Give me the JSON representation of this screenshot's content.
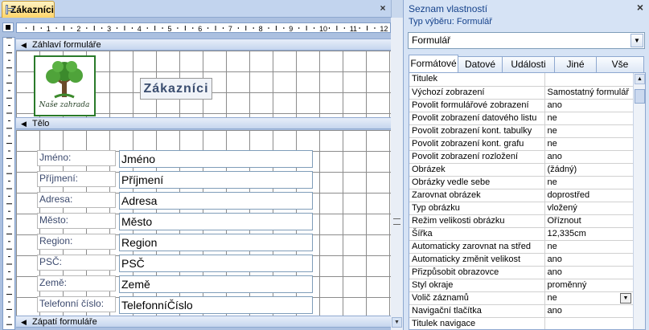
{
  "document_tab": {
    "title": "Zákazníci",
    "icon": "form-icon"
  },
  "form": {
    "header_section": "Záhlaví formuláře",
    "logo_text": "Naše zahrada",
    "title_label": "Zákazníci",
    "detail_section": "Tělo",
    "footer_section": "Zápatí formuláře",
    "fields": [
      {
        "label": "Jméno:",
        "value": "Jméno"
      },
      {
        "label": "Příjmení:",
        "value": "Příjmení"
      },
      {
        "label": "Adresa:",
        "value": "Adresa"
      },
      {
        "label": "Město:",
        "value": "Město"
      },
      {
        "label": "Region:",
        "value": "Region"
      },
      {
        "label": "PSČ:",
        "value": "PSČ"
      },
      {
        "label": "Země:",
        "value": "Země"
      },
      {
        "label": "Telefonní číslo:",
        "value": "TelefonníČíslo"
      }
    ]
  },
  "ruler": {
    "labels": [
      "1",
      "2",
      "3",
      "4",
      "5",
      "6",
      "7",
      "8",
      "9",
      "10",
      "11",
      "12"
    ]
  },
  "properties": {
    "title": "Seznam vlastností",
    "selection_type_label": "Typ výběru:  Formulář",
    "selected_object": "Formulář",
    "tabs": [
      "Formátové",
      "Datové",
      "Události",
      "Jiné",
      "Vše"
    ],
    "active_tab": "Formátové",
    "rows": [
      {
        "name": "Titulek",
        "value": ""
      },
      {
        "name": "Výchozí zobrazení",
        "value": "Samostatný formulář"
      },
      {
        "name": "Povolit formulářové zobrazení",
        "value": "ano"
      },
      {
        "name": "Povolit zobrazení datového listu",
        "value": "ne"
      },
      {
        "name": "Povolit zobrazení kont. tabulky",
        "value": "ne"
      },
      {
        "name": "Povolit zobrazení kont. grafu",
        "value": "ne"
      },
      {
        "name": "Povolit zobrazení rozložení",
        "value": "ano"
      },
      {
        "name": "Obrázek",
        "value": "(žádný)"
      },
      {
        "name": "Obrázky vedle sebe",
        "value": "ne"
      },
      {
        "name": "Zarovnat obrázek",
        "value": "doprostřed"
      },
      {
        "name": "Typ obrázku",
        "value": "vložený"
      },
      {
        "name": "Režim velikosti obrázku",
        "value": "Oříznout"
      },
      {
        "name": "Šířka",
        "value": "12,335cm"
      },
      {
        "name": "Automaticky zarovnat na střed",
        "value": "ne"
      },
      {
        "name": "Automaticky změnit velikost",
        "value": "ano"
      },
      {
        "name": "Přizpůsobit obrazovce",
        "value": "ano"
      },
      {
        "name": "Styl okraje",
        "value": "proměnný"
      },
      {
        "name": "Volič záznamů",
        "value": "ne"
      },
      {
        "name": "Navigační tlačítka",
        "value": "ano"
      },
      {
        "name": "Titulek navigace",
        "value": ""
      }
    ],
    "dropdown_row": "Volič záznamů"
  }
}
